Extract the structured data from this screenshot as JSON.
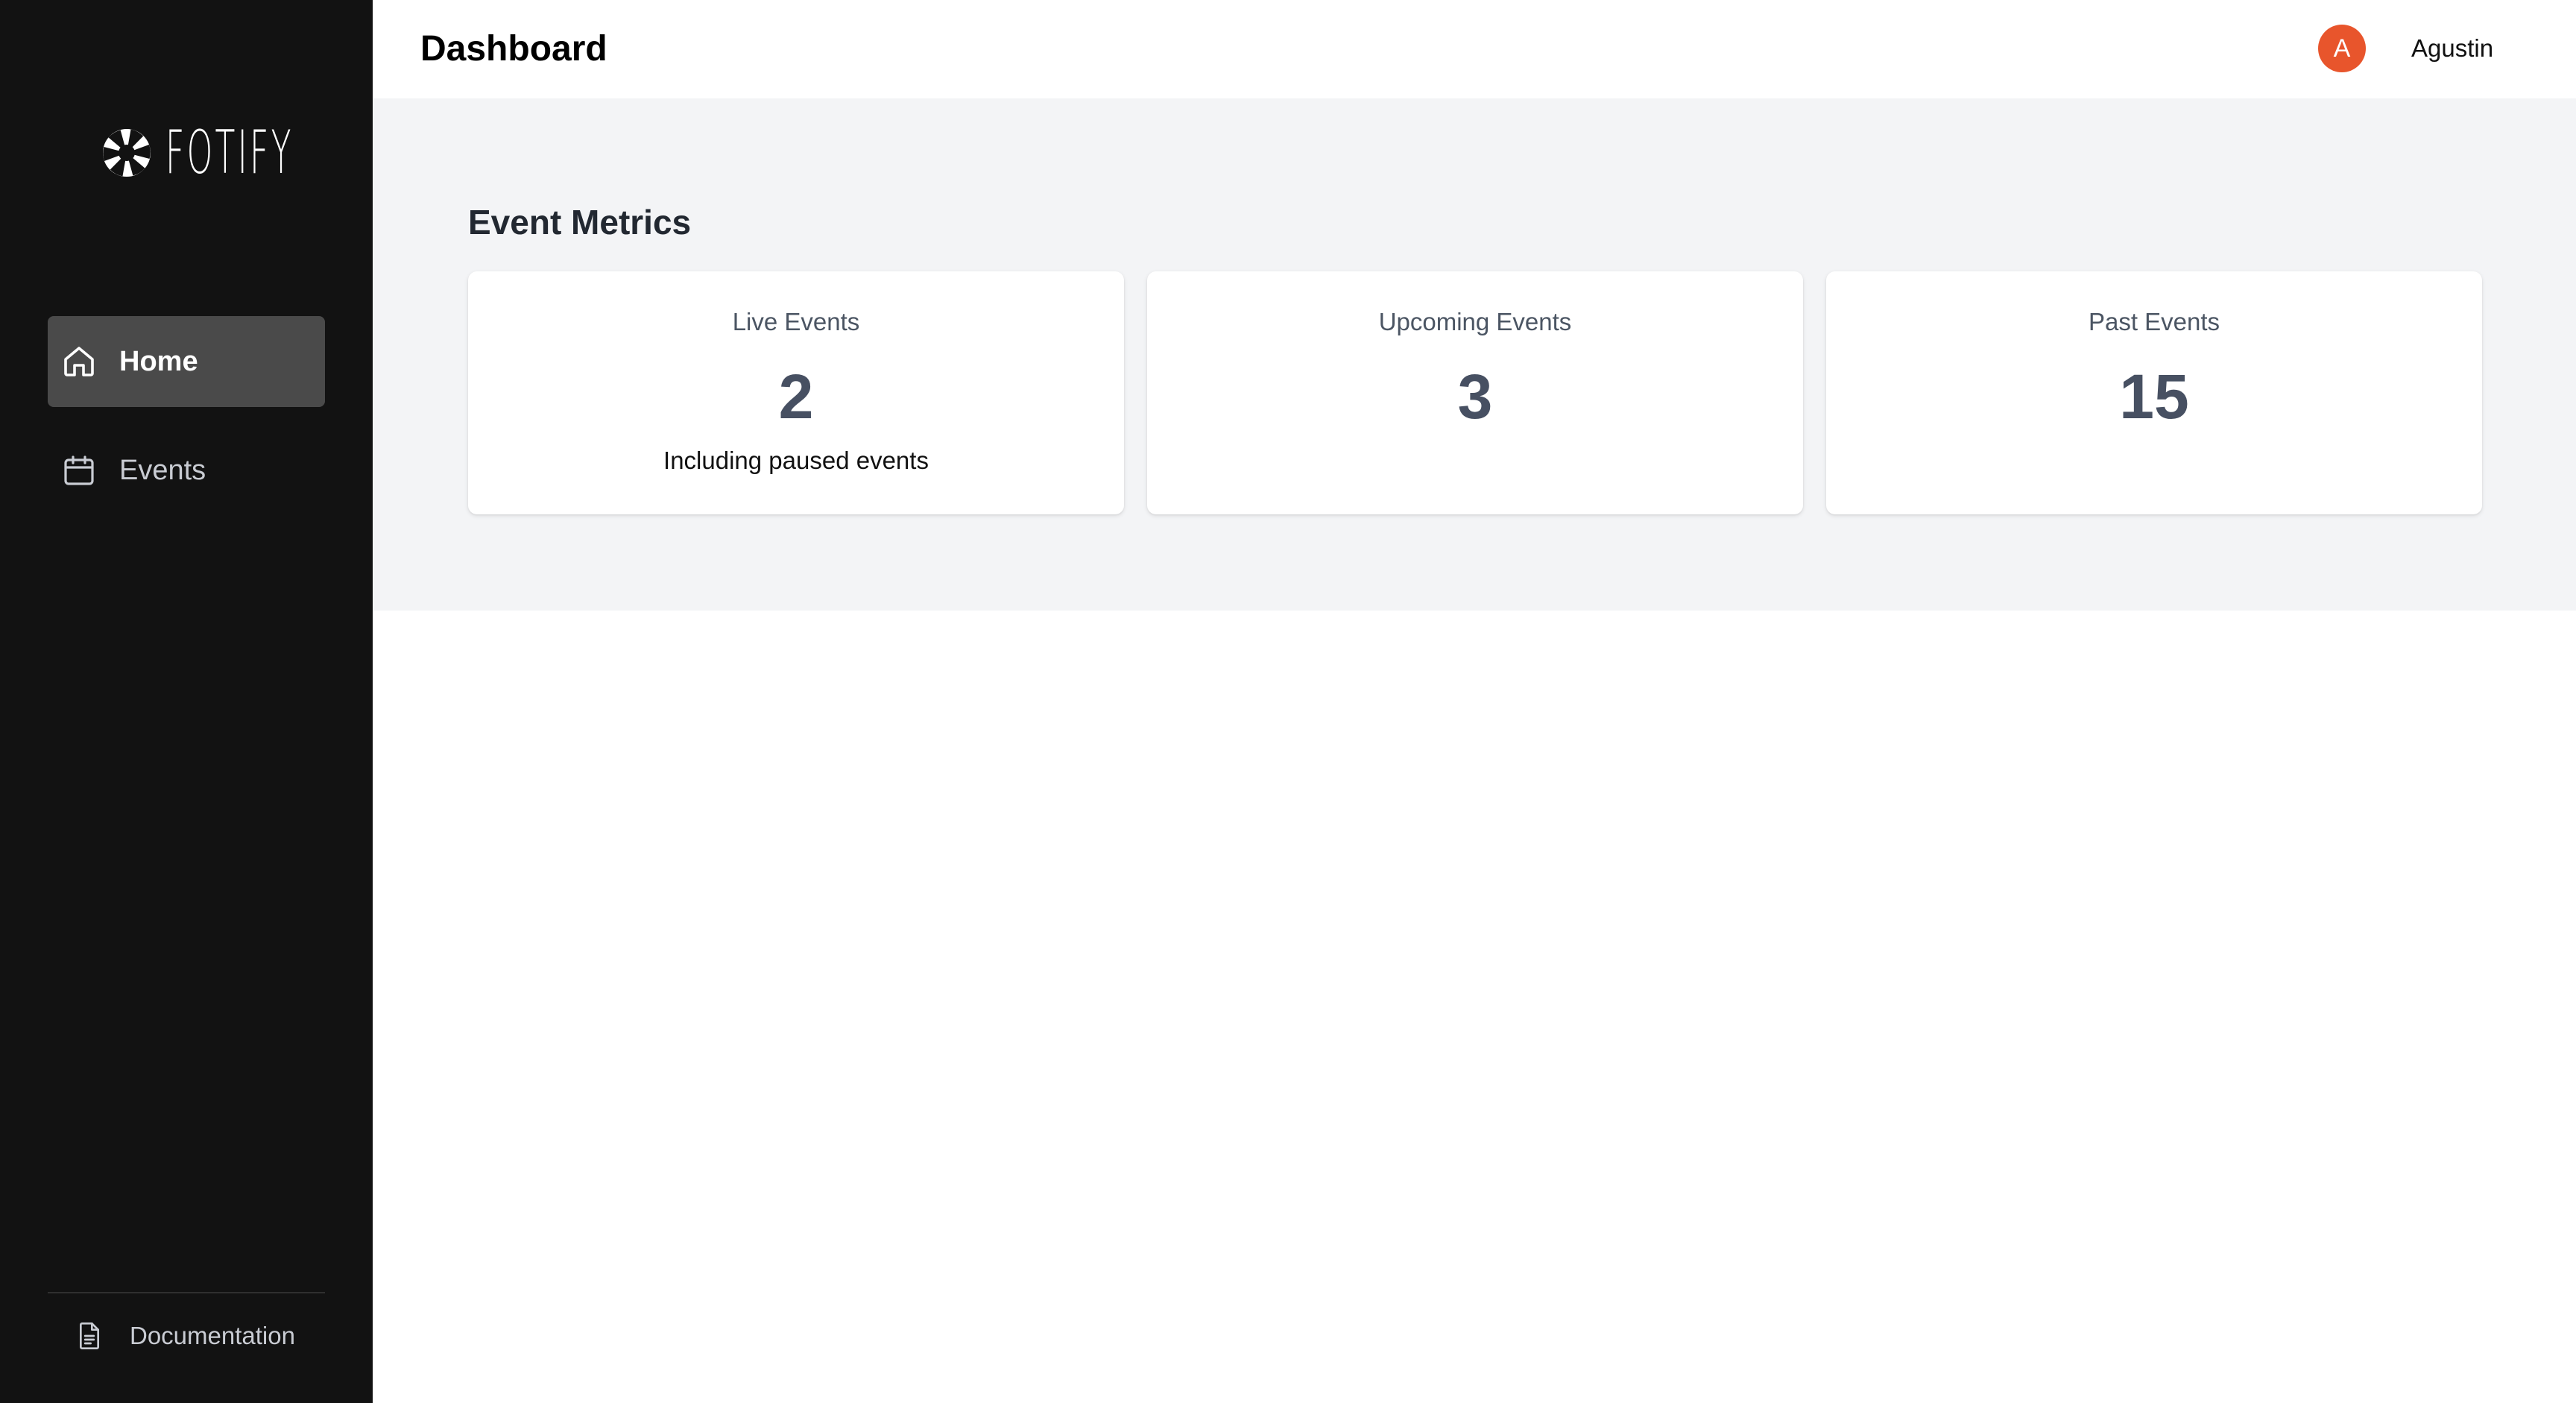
{
  "sidebar": {
    "logo_text": "FOTIFY",
    "nav_items": [
      {
        "label": "Home",
        "icon": "home-icon",
        "active": true
      },
      {
        "label": "Events",
        "icon": "calendar-icon",
        "active": false
      }
    ],
    "footer_link": {
      "label": "Documentation",
      "icon": "document-icon"
    }
  },
  "header": {
    "title": "Dashboard",
    "user": {
      "avatar_initial": "A",
      "name": "Agustin",
      "avatar_color": "#e8552c"
    }
  },
  "metrics": {
    "section_title": "Event Metrics",
    "cards": [
      {
        "label": "Live Events",
        "value": "2",
        "note": "Including paused events"
      },
      {
        "label": "Upcoming Events",
        "value": "3"
      },
      {
        "label": "Past Events",
        "value": "15"
      }
    ]
  },
  "colors": {
    "sidebar_bg": "#121212",
    "active_nav_bg": "#4a4a4a",
    "content_band_bg": "#f3f4f6",
    "metric_value": "#475062"
  }
}
